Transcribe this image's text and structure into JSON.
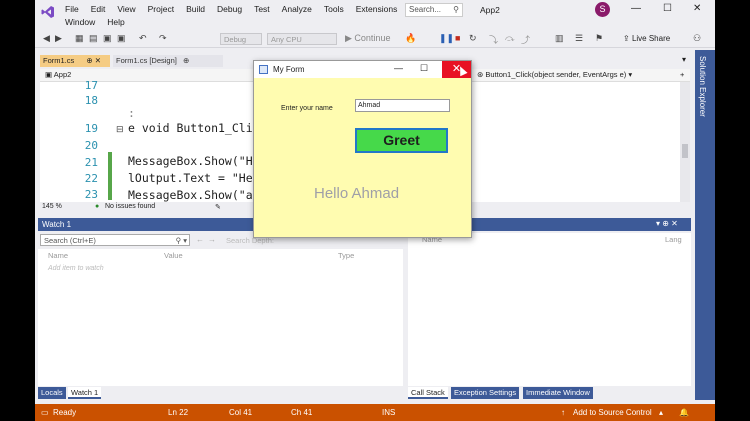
{
  "menu": {
    "row1": [
      "File",
      "Edit",
      "View",
      "Project",
      "Build",
      "Debug",
      "Test",
      "Analyze",
      "Tools",
      "Extensions"
    ],
    "row2": [
      "Window",
      "Help"
    ],
    "search_placeholder": "Search...",
    "app_name": "App2",
    "avatar_initial": "S"
  },
  "toolbar": {
    "config": "Debug",
    "platform": "Any CPU",
    "continue_label": "Continue",
    "live_share": "Live Share"
  },
  "tabs": {
    "tab1": "Form1.cs",
    "tab2": "Form1.cs [Design]",
    "nav_project": "App2",
    "nav_method": "Button1_Click(object sender, EventArgs e)"
  },
  "editor": {
    "lines": [
      {
        "n": "17",
        "code": ""
      },
      {
        "n": "18",
        "code": ":"
      },
      {
        "n": "19",
        "code": "e void Button1_Clic"
      },
      {
        "n": "20",
        "code": ""
      },
      {
        "n": "21",
        "code": "MessageBox.Show(\"H"
      },
      {
        "n": "22",
        "code": "lOutput.Text = \"He"
      },
      {
        "n": "23",
        "code": "MessageBox.Show(\"a"
      }
    ],
    "zoom": "145 %",
    "issues": "No issues found"
  },
  "watch": {
    "title": "Watch 1",
    "search_placeholder": "Search (Ctrl+E)",
    "search_depth": "Search Depth:",
    "col_name": "Name",
    "col_value": "Value",
    "col_type": "Type",
    "add_item": "Add item to watch",
    "tab_locals": "Locals",
    "tab_watch": "Watch 1"
  },
  "right_panel": {
    "col_name": "Name",
    "col_lang": "Lang",
    "tab_callstack": "Call Stack",
    "tab_exceptions": "Exception Settings",
    "tab_immediate": "Immediate Window"
  },
  "solution_explorer": "Solution Explorer",
  "status": {
    "ready": "Ready",
    "ln": "Ln 22",
    "col": "Col 41",
    "ch": "Ch 41",
    "ins": "INS",
    "source_control": "Add to Source Control"
  },
  "form": {
    "title": "My Form",
    "label": "Enter your name",
    "input_value": "Ahmad",
    "button_label": "Greet",
    "output": "Hello Ahmad",
    "close_glyph": "✕",
    "min_glyph": "—",
    "max_glyph": "☐"
  },
  "colors": {
    "accent_blue": "#3d5a98",
    "status_orange": "#ca5100",
    "form_bg": "#fffcb0",
    "greet_green": "#46d94a"
  }
}
